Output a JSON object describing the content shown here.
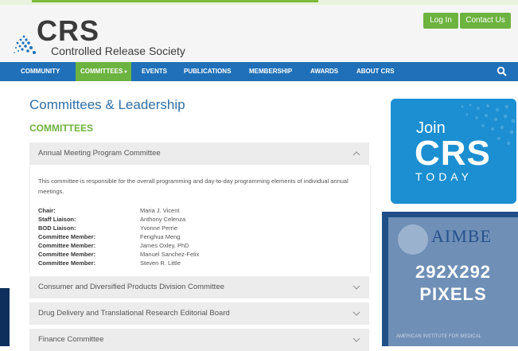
{
  "header": {
    "logo_text": "CRS",
    "logo_subtitle": "Controlled Release Society",
    "login_label": "Log In",
    "contact_label": "Contact Us"
  },
  "nav": {
    "items": [
      {
        "label": "COMMUNITY"
      },
      {
        "label": "COMMITTEES",
        "active": true
      },
      {
        "label": "EVENTS"
      },
      {
        "label": "PUBLICATIONS"
      },
      {
        "label": "MEMBERSHIP"
      },
      {
        "label": "AWARDS"
      },
      {
        "label": "ABOUT CRS"
      }
    ],
    "search_icon": "search-icon"
  },
  "main": {
    "page_title": "Committees & Leadership",
    "section_title": "COMMITTEES",
    "accordion": [
      {
        "title": "Annual Meeting Program Committee",
        "expanded": true,
        "description": "This committee is responsible for the overall programming and day-to-day programming elements of individual annual meetings.",
        "members": [
          {
            "role": "Chair:",
            "name": "Maria J. Vicent"
          },
          {
            "role": "Staff Liaison:",
            "name": "Anthony Celenza"
          },
          {
            "role": "BOD Liaison:",
            "name": "Yvonne Perrie"
          },
          {
            "role": "Committee Member:",
            "name": "Fenghua Meng"
          },
          {
            "role": "Committee Member:",
            "name": "James Oxley, PhD"
          },
          {
            "role": "Committee Member:",
            "name": "Manuel Sanchez-Felix"
          },
          {
            "role": "Committee Member:",
            "name": "Steven R. Little"
          }
        ]
      },
      {
        "title": "Consumer and Diversified Products Division Committee",
        "expanded": false
      },
      {
        "title": "Drug Delivery and Translational Research Editorial Board",
        "expanded": false
      },
      {
        "title": "Finance Committee",
        "expanded": false
      }
    ]
  },
  "sidebar": {
    "join_word": "Join",
    "join_crs": "CRS",
    "join_today": "TODAY",
    "ad_brand": "AIMBE",
    "ad_label_line1": "292X292",
    "ad_label_line2": "PIXELS",
    "ad_footer": "AMERICAN INSTITUTE FOR MEDICAL"
  },
  "colors": {
    "nav_blue": "#1f70b8",
    "accent_green": "#6db33f",
    "title_blue": "#2e6ea6",
    "join_blue": "#1b8fd1"
  }
}
